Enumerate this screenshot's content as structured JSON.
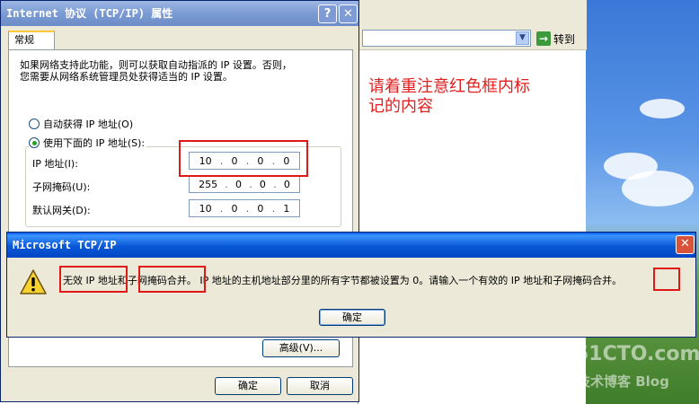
{
  "props_dialog": {
    "title": "Internet 协议 (TCP/IP) 属性",
    "help_glyph": "?",
    "close_glyph": "✕",
    "tab_label": "常规",
    "description_line1": "如果网络支持此功能，则可以获取自动指派的 IP 设置。否则，",
    "description_line2": "您需要从网络系统管理员处获得适当的 IP 设置。",
    "radio_auto": "自动获得 IP 地址(O)",
    "radio_manual": "使用下面的 IP 地址(S):",
    "ip_label": "IP 地址(I):",
    "ip_value": [
      "10",
      "0",
      "0",
      "0"
    ],
    "mask_label": "子网掩码(U):",
    "mask_value": [
      "255",
      "0",
      "0",
      "0"
    ],
    "gateway_label": "默认网关(D):",
    "gateway_value": [
      "10",
      "0",
      "0",
      "1"
    ],
    "advanced_label": "高级(V)...",
    "ok_label": "确定",
    "cancel_label": "取消"
  },
  "browser": {
    "goto_label": "转到",
    "dropdown_glyph": "▼",
    "go_glyph": "→"
  },
  "annotation": {
    "note_line1": "请着重注意红色框内标",
    "note_line2": "记的内容",
    "note_color": "#e02020"
  },
  "error_box": {
    "title": "Microsoft TCP/IP",
    "close_glyph": "✕",
    "msg_part1": "无效 IP 地址",
    "msg_part2": "和",
    "msg_part3": "子网掩码合并",
    "msg_part4": "。 IP 地址的主机地址部分里的所有字节都被设置为 0。请输入一个有效的 IP 地址和子网掩码",
    "msg_part5": "合并",
    "msg_part6": "。",
    "ok_label": "确定",
    "icon": "warning-icon"
  },
  "watermark": {
    "line1": "51CTO.com",
    "line2": "技术博客 Blog"
  }
}
